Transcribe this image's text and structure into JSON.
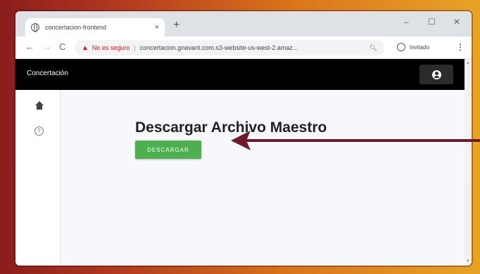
{
  "browser": {
    "tab_title": "concertacion-frontend",
    "tab_close": "×",
    "new_tab": "+",
    "window_controls": {
      "minimize": "–",
      "maximize": "☐",
      "close": "✕"
    },
    "back": "←",
    "forward": "→",
    "reload": "C",
    "security_warning": "No es seguro",
    "separator": "|",
    "url": "concertacion.gnavant.com.s3-website-us-west-2.amaz...",
    "profile_label": "Invitado",
    "menu": "⋮"
  },
  "app": {
    "title": "Concertación",
    "account_icon": "account-circle-icon"
  },
  "sidebar": {
    "items": [
      {
        "icon": "home-icon"
      },
      {
        "icon": "info-circle-icon"
      }
    ]
  },
  "main": {
    "heading": "Descargar Archivo Maestro",
    "download_button": "DESCARGAR"
  },
  "colors": {
    "app_bar": "#000000",
    "download_button": "#4caf50",
    "annotation_arrow": "#6e1a2c"
  }
}
